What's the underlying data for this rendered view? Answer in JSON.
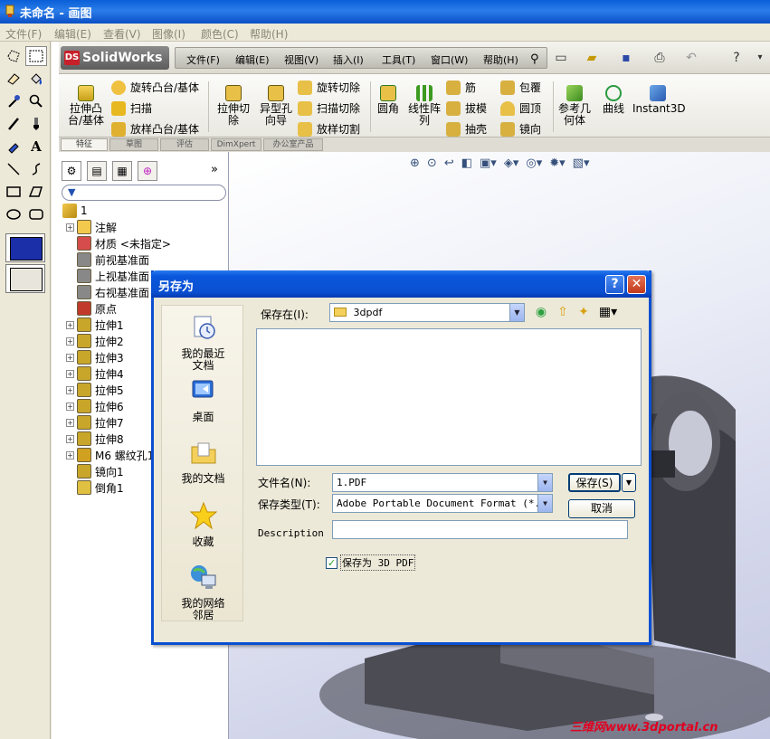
{
  "paint": {
    "title": "未命名 - 画图",
    "menu": [
      "文件(F)",
      "编辑(E)",
      "查看(V)",
      "图像(I)",
      "颜色(C)",
      "帮助(H)"
    ],
    "tools": [
      "free-select-icon",
      "rect-select-icon",
      "eraser-icon",
      "fill-icon",
      "picker-icon",
      "magnifier-icon",
      "pencil-icon",
      "brush-icon",
      "airbrush-icon",
      "text-icon",
      "line-icon",
      "curve-icon",
      "rect-icon",
      "polygon-icon",
      "ellipse-icon",
      "rounded-rect-icon"
    ]
  },
  "solidworks": {
    "logo": "SolidWorks",
    "logo_badge": "DS",
    "menu": [
      "文件(F)",
      "编辑(E)",
      "视图(V)",
      "插入(I)",
      "工具(T)",
      "窗口(W)",
      "帮助(H)"
    ],
    "commands": {
      "extrude_boss": "拉伸凸台/基体",
      "revolve_boss": "旋转凸台/基体",
      "sweep": "扫描",
      "loft_boss": "放样凸台/基体",
      "extrude_cut": "拉伸切除",
      "hole_wizard": "异型孔向导",
      "revolve_cut": "旋转切除",
      "sweep_cut": "扫描切除",
      "loft_cut": "放样切割",
      "fillet": "圆角",
      "linear_pattern": "线性阵列",
      "rib": "筋",
      "draft": "拔模",
      "shell": "抽壳",
      "wrap": "包覆",
      "dome": "圆顶",
      "mirror": "镜向",
      "ref_geometry": "参考几何体",
      "curves": "曲线",
      "instant3d": "Instant3D"
    },
    "tabs": [
      "特征",
      "草图",
      "评估",
      "DimXpert",
      "办公室产品"
    ],
    "tree": {
      "root": "1",
      "items": [
        "注解",
        "材质 <未指定>",
        "前视基准面",
        "上视基准面",
        "右视基准面",
        "原点",
        "拉伸1",
        "拉伸2",
        "拉伸3",
        "拉伸4",
        "拉伸5",
        "拉伸6",
        "拉伸7",
        "拉伸8",
        "M6 螺纹孔1",
        "镜向1",
        "倒角1"
      ]
    }
  },
  "dialog": {
    "title": "另存为",
    "save_in_label": "保存在(I):",
    "save_in_value": "3dpdf",
    "places": [
      "我的最近文档",
      "桌面",
      "我的文档",
      "收藏",
      "我的网络邻居"
    ],
    "filename_label": "文件名(N):",
    "filename_value": "1.PDF",
    "filetype_label": "保存类型(T):",
    "filetype_value": "Adobe Portable Document Format (*.pdf)",
    "description_label": "Description",
    "description_value": "",
    "save_3d_label": "保存为 3D PDF",
    "save_3d_checked": true,
    "save_button": "保存(S)",
    "cancel_button": "取消",
    "help_button": "?",
    "close_button": "✕"
  },
  "watermark": "三维网www.3dportal.cn",
  "colors": {
    "xp_title": "#0a4fd2",
    "sw_menu_bar": "#dcdad0",
    "viewport_bg": "#d6d9ec",
    "watermark": "#e00020"
  }
}
